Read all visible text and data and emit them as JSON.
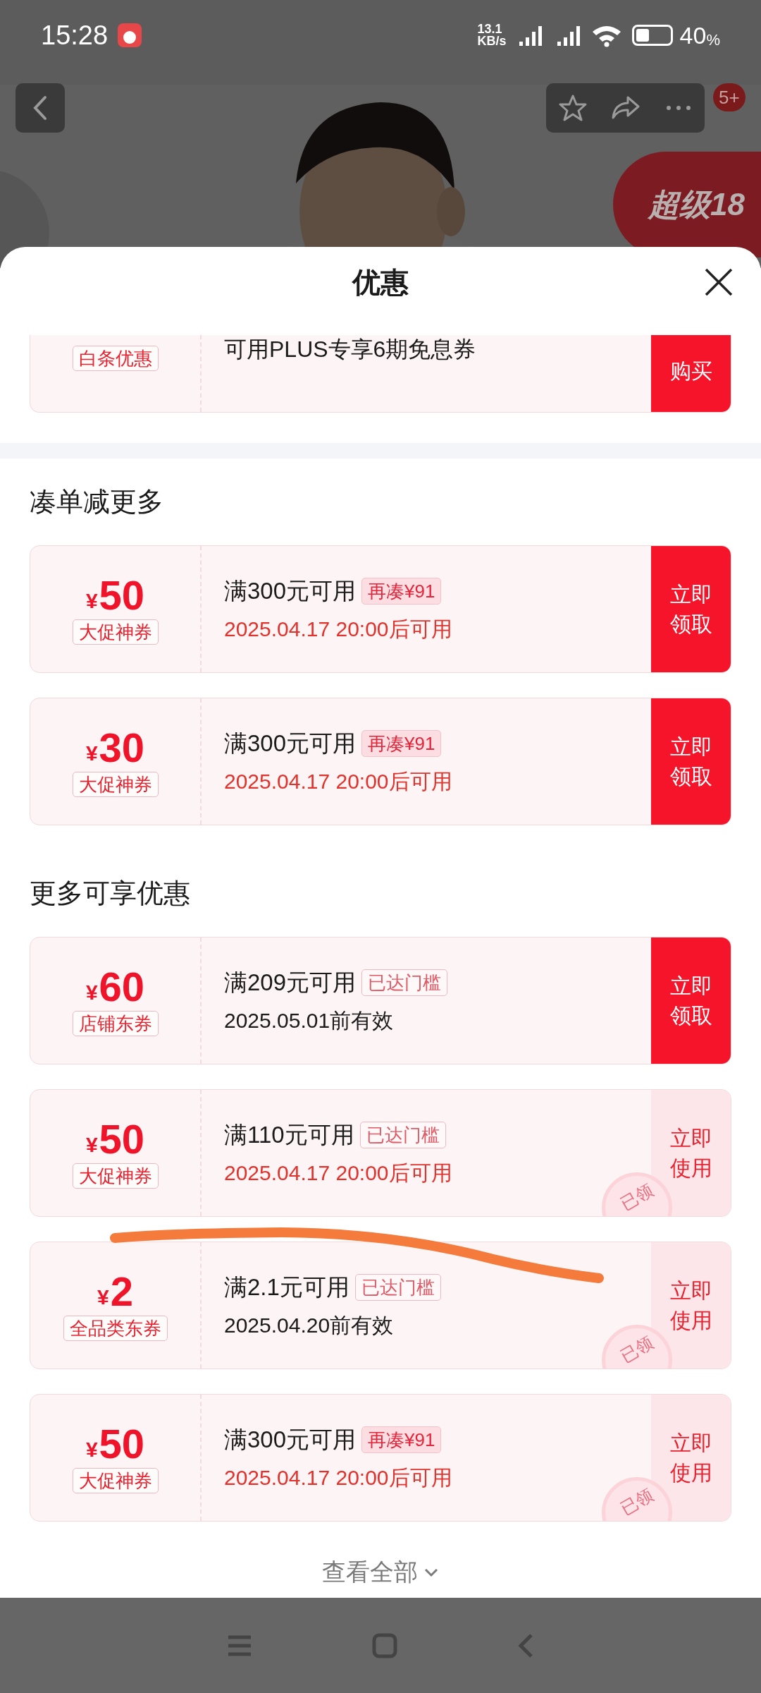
{
  "status_bar": {
    "time": "15:28",
    "net_speed": [
      "13.1",
      "KB/s"
    ],
    "battery_text": "40",
    "battery_unit": "%"
  },
  "header": {
    "message_badge": "5+",
    "promo_badge": "超级18"
  },
  "sheet": {
    "title": "优惠",
    "partial_coupon": {
      "tag": "白条优惠",
      "title": "可用PLUS专享6期免息券",
      "button": "购买"
    },
    "sections": [
      {
        "title": "凑单减更多",
        "coupons": [
          {
            "currency": "¥",
            "amount": "50",
            "tag": "大促神券",
            "condition": "满300元可用",
            "badge": "再凑¥91",
            "threshold_reached": false,
            "date": "2025.04.17 20:00后可用",
            "date_highlighted": true,
            "button": "立即领取",
            "claimed": false
          },
          {
            "currency": "¥",
            "amount": "30",
            "tag": "大促神券",
            "condition": "满300元可用",
            "badge": "再凑¥91",
            "threshold_reached": false,
            "date": "2025.04.17 20:00后可用",
            "date_highlighted": true,
            "button": "立即领取",
            "claimed": false
          }
        ]
      },
      {
        "title": "更多可享优惠",
        "coupons": [
          {
            "currency": "¥",
            "amount": "60",
            "tag": "店铺东券",
            "condition": "满209元可用",
            "badge": "已达门槛",
            "threshold_reached": true,
            "date": "2025.05.01前有效",
            "date_highlighted": false,
            "button": "立即领取",
            "claimed": false
          },
          {
            "currency": "¥",
            "amount": "50",
            "tag": "大促神券",
            "condition": "满110元可用",
            "badge": "已达门槛",
            "threshold_reached": true,
            "date": "2025.04.17 20:00后可用",
            "date_highlighted": true,
            "button": "立即使用",
            "claimed": true,
            "stamp": "已领"
          },
          {
            "currency": "¥",
            "amount": "2",
            "tag": "全品类东券",
            "condition": "满2.1元可用",
            "badge": "已达门槛",
            "threshold_reached": true,
            "date": "2025.04.20前有效",
            "date_highlighted": false,
            "button": "立即使用",
            "claimed": true,
            "stamp": "已领"
          },
          {
            "currency": "¥",
            "amount": "50",
            "tag": "大促神券",
            "condition": "满300元可用",
            "badge": "再凑¥91",
            "threshold_reached": false,
            "date": "2025.04.17 20:00后可用",
            "date_highlighted": true,
            "button": "立即使用",
            "claimed": true,
            "stamp": "已领"
          }
        ]
      }
    ],
    "view_all": "查看全部"
  }
}
